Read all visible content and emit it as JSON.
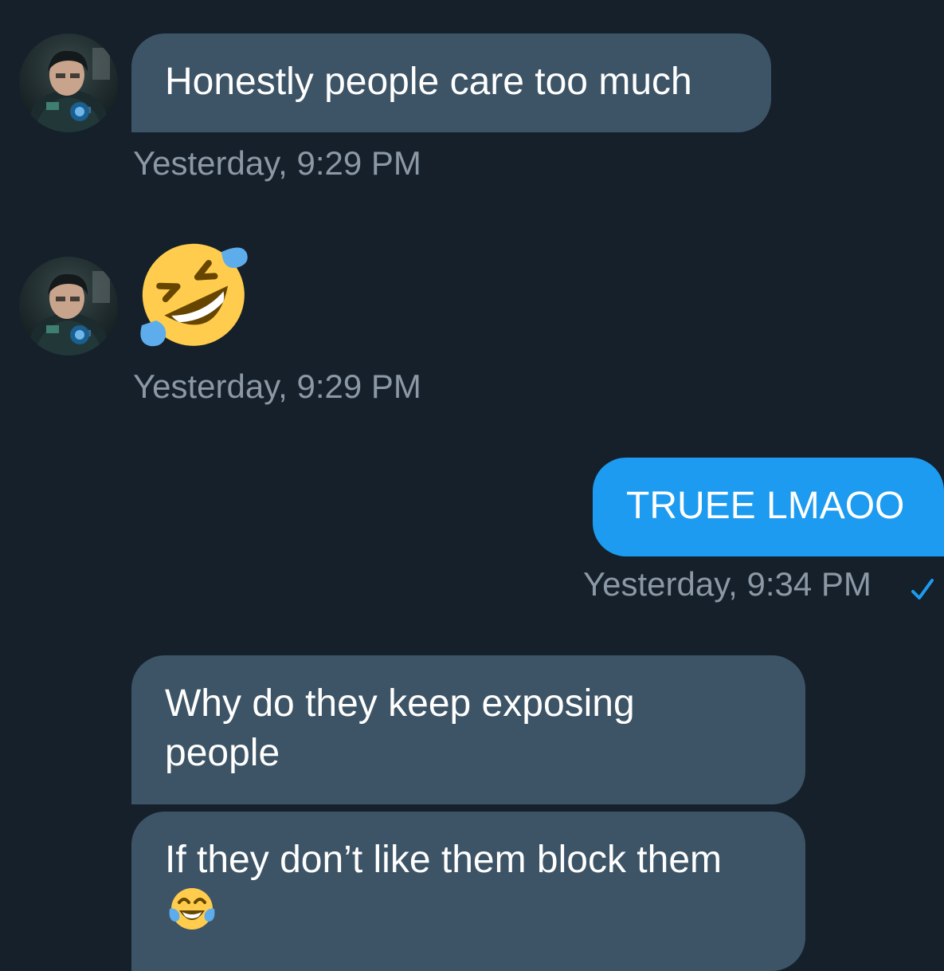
{
  "messages": [
    {
      "sender": "other",
      "text": "Honestly people care too much",
      "timestamp": "Yesterday, 9:29 PM"
    },
    {
      "sender": "other",
      "emoji": "rolling-on-floor-laughing-emoji",
      "timestamp": "Yesterday, 9:29 PM"
    },
    {
      "sender": "self",
      "text": "TRUEE LMAOO",
      "timestamp": "Yesterday, 9:34 PM",
      "status": "sent-check"
    },
    {
      "sender": "other",
      "text": "Why do they keep exposing people"
    },
    {
      "sender": "other",
      "text": "If they don’t like them block them",
      "trailing_emoji": "face-with-tears-of-joy-emoji"
    }
  ],
  "colors": {
    "background": "#15202b",
    "received_bubble": "#3d5466",
    "sent_bubble": "#1d9bf0",
    "timestamp": "#8b98a5",
    "check": "#1d9bf0"
  }
}
